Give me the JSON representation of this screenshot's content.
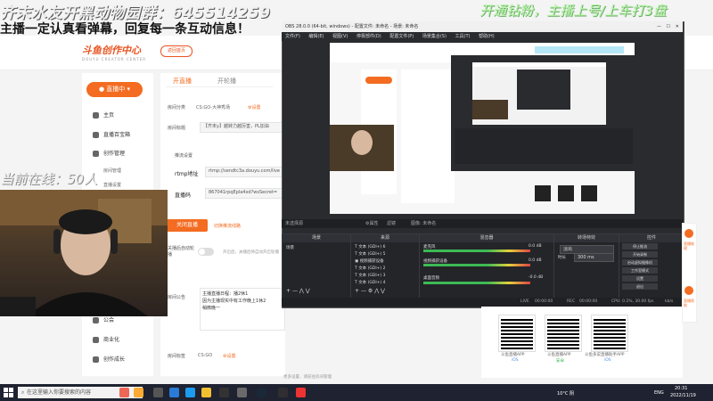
{
  "overlay": {
    "title": "齐末水友开黑动物园群：645514259",
    "subtitle": "主播一定认真看弹幕，回复每一条互动信息！",
    "right_banner": "开通钻粉，主播上号/上车打3盘",
    "online": "当前在线：50人"
  },
  "site": {
    "logo": "斗鱼创作中心",
    "logo_sub": "DOUYU CREATOR CENTER",
    "back_home": "返回首页",
    "live_button": "直播中",
    "sidebar": [
      {
        "label": "主页",
        "icon": "home-icon"
      },
      {
        "label": "直播百宝箱",
        "icon": "toolbox-icon"
      },
      {
        "label": "创作管理",
        "icon": "create-icon"
      }
    ],
    "sidebar_sub": [
      "房间管理",
      "直播设置"
    ],
    "sidebar_bottom": [
      {
        "label": "公会",
        "icon": "guild-icon"
      },
      {
        "label": "商业化",
        "icon": "commerce-icon"
      },
      {
        "label": "创作成长",
        "icon": "growth-icon"
      }
    ],
    "tabs": [
      "开直播",
      "开轮播"
    ],
    "form": {
      "category_label": "房间分类",
      "category_value": "CS:GO-大神秀场",
      "category_setting": "设置",
      "title_label": "房间标题",
      "title_value": "【齐末y】越转力越厉害，PL加油",
      "push_settings": "推流设置",
      "rtmp_label": "rtmp地址",
      "rtmp_value": "rtmp://sendtc3a.douyu.com/live",
      "code_label": "直播码",
      "code_value": "867041rpqEpla4xd?wsSecret=",
      "stop_live": "关闭直播",
      "switch_link": "切换推流线路",
      "auto_record_label": "关播后自动轮播",
      "auto_record_desc": "开启后，关播后将自动开启轮播",
      "announce_label": "房间公告",
      "announce_lines": [
        "主播直播日程：播2休1",
        "因为主播现实中有工作晚上1休2",
        "稍微晚一"
      ],
      "tag_label": "房间标签",
      "tag_value": "CS:GO",
      "tag_setting": "设置",
      "more_settings": "更多设置，请前往房间管理"
    }
  },
  "obs": {
    "title": "OBS 28.0.0 (64-bit, windows) - 配置文件: 未命名 - 场景: 未命名",
    "menu": [
      "文件(F)",
      "编辑(E)",
      "视图(V)",
      "停靠部件(D)",
      "配置文件(P)",
      "场景集合(S)",
      "工具(T)",
      "帮助(H)"
    ],
    "status_left": "未选择源",
    "status_props": "属性",
    "status_filters": "滤镜",
    "status_image": "图像: 未命名",
    "docks": {
      "scenes": "场景",
      "sources": "来源",
      "mixer": "混音器",
      "transitions": "转场特效",
      "controls": "控件"
    },
    "scene_items": [
      "场景"
    ],
    "source_items": [
      "文本 (GDI+) 6",
      "文本 (GDI+) 5",
      "视频捕获设备",
      "文本 (GDI+) 2",
      "文本 (GDI+) 3",
      "文本 (GDI+) 4"
    ],
    "mixer_items": [
      {
        "name": "麦克风",
        "db": "0.0 dB"
      },
      {
        "name": "视频捕获设备",
        "db": "0.0 dB"
      },
      {
        "name": "桌面音频",
        "db": "-0.0 dB"
      }
    ],
    "transition_value": "淡出",
    "duration_label": "时长",
    "duration_value": "300 ms",
    "controls": [
      "停止推流",
      "开始录制",
      "启动虚拟摄像机",
      "工作室模式",
      "设置",
      "退出"
    ],
    "bottom_status": {
      "live_label": "LIVE",
      "live_time": "00:00:00",
      "rec_label": "REC",
      "rec_time": "00:00:00",
      "cpu": "CPU: 0.2%, 30.00 fps",
      "kbps": "kb/s"
    }
  },
  "qr_panel": {
    "items": [
      {
        "caption": "斗鱼直播APP",
        "sub": "iOS"
      },
      {
        "caption": "斗鱼直播APP",
        "sub": "安卓"
      },
      {
        "caption": "斗鱼多说直播助手APP",
        "sub": "iOS"
      }
    ]
  },
  "float_bar": [
    "直播助理",
    "直播帮助"
  ],
  "taskbar": {
    "search_placeholder": "在这里输入你要搜索的内容",
    "weather": "10°C 阴",
    "lang": "ENG",
    "time": "20:31",
    "date": "2022/11/19"
  },
  "colors": {
    "accent": "#f36c21",
    "obs_bg": "#2a2b2f",
    "taskbar": "#1f2230"
  }
}
